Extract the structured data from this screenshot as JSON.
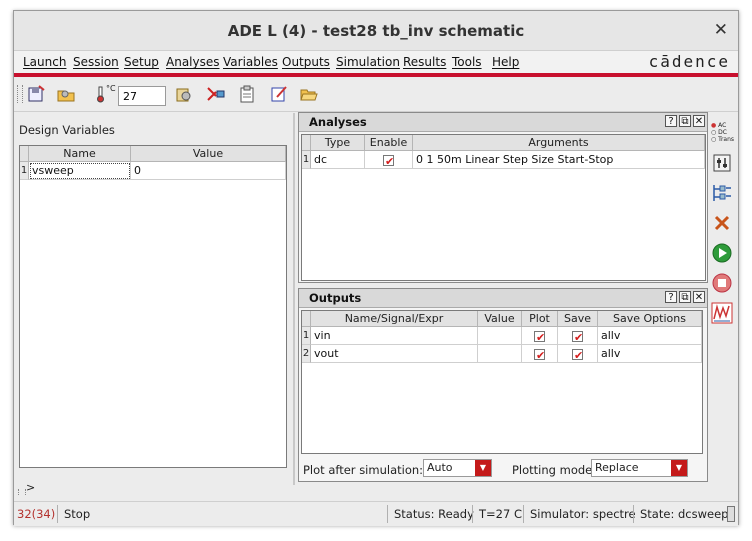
{
  "window": {
    "title": "ADE L (4) - test28 tb_inv schematic",
    "close_glyph": "✕"
  },
  "menu": {
    "items": [
      "Launch",
      "Session",
      "Setup",
      "Analyses",
      "Variables",
      "Outputs",
      "Simulation",
      "Results",
      "Tools",
      "Help"
    ],
    "brand": "cādence"
  },
  "toolbar": {
    "temperature_value": "27",
    "temperature_unit": "°C"
  },
  "design_variables": {
    "label": "Design Variables",
    "columns": [
      "Name",
      "Value"
    ],
    "rows": [
      {
        "num": "1",
        "name": "vsweep",
        "value": "0"
      }
    ],
    "footer": ">"
  },
  "analyses": {
    "title": "Analyses",
    "columns": [
      "Type",
      "Enable",
      "Arguments"
    ],
    "rows": [
      {
        "num": "1",
        "type": "dc",
        "enabled": true,
        "arguments": "0 1 50m Linear Step Size Start-Stop"
      }
    ]
  },
  "outputs": {
    "title": "Outputs",
    "columns": [
      "Name/Signal/Expr",
      "Value",
      "Plot",
      "Save",
      "Save Options"
    ],
    "rows": [
      {
        "num": "1",
        "name": "vin",
        "value": "",
        "plot": true,
        "save": true,
        "save_options": "allv"
      },
      {
        "num": "2",
        "name": "vout",
        "value": "",
        "plot": true,
        "save": true,
        "save_options": "allv"
      }
    ],
    "plot_after_label": "Plot after simulation:",
    "plot_after_value": "Auto",
    "plotting_mode_label": "Plotting mode:",
    "plotting_mode_value": "Replace"
  },
  "dock_buttons": {
    "help": "?",
    "float": "⧉",
    "close": "✕"
  },
  "right_toolbar": {
    "ac": "AC",
    "dc": "DC",
    "trans": "Trans"
  },
  "status": {
    "count": "32(34)",
    "action": "Stop",
    "status": "Status: Ready",
    "temp": "T=27 C",
    "simulator": "Simulator: spectre",
    "state": "State: dcsweep"
  },
  "colors": {
    "accent_red": "#c8102e",
    "check_red": "#d41c1c",
    "run_green": "#2e9b3a"
  }
}
